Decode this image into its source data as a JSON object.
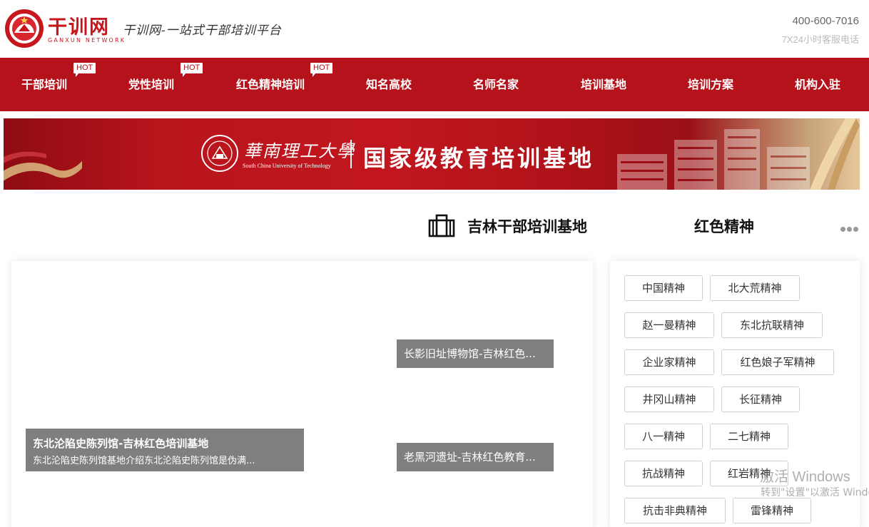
{
  "header": {
    "brand_name": "干训网",
    "brand_sub": "GANXUN NETWORK",
    "slogan": "干训网-一站式干部培训平台",
    "phone": "400-600-7016",
    "phone_note": "7X24小时客服电话"
  },
  "nav": {
    "items": [
      {
        "label": "干部培训",
        "badge": "HOT"
      },
      {
        "label": "党性培训",
        "badge": "HOT"
      },
      {
        "label": "红色精神培训",
        "badge": "HOT"
      },
      {
        "label": "知名高校"
      },
      {
        "label": "名师名家"
      },
      {
        "label": "培训基地"
      },
      {
        "label": "培训方案"
      },
      {
        "label": "机构入驻"
      }
    ]
  },
  "banner": {
    "university": "華南理工大學",
    "university_en": "South China University of Technology",
    "title": "国家级教育培训基地"
  },
  "section": {
    "tab_active": "吉林干部培训基地",
    "tab_red": "红色精神"
  },
  "features": {
    "main_title": "东北沦陷史陈列馆-吉林红色培训基地",
    "main_desc": "东北沦陷史陈列馆基地介绍东北沦陷史陈列馆是伪满...",
    "item1": "长影旧址博物馆-吉林红色...",
    "item2": "老黑河遗址-吉林红色教育..."
  },
  "spirit_tags": [
    "中国精神",
    "北大荒精神",
    "赵一曼精神",
    "东北抗联精神",
    "企业家精神",
    "红色娘子军精神",
    "井冈山精神",
    "长征精神",
    "八一精神",
    "二七精神",
    "抗战精神",
    "红岩精神",
    "抗击非典精神",
    "雷锋精神"
  ],
  "watermark": {
    "line1": "激活 Windows",
    "line2": "转到\"设置\"以激活 Windows"
  },
  "colors": {
    "brand_red": "#b5121b",
    "caption_gray": "#7f7f7f"
  }
}
